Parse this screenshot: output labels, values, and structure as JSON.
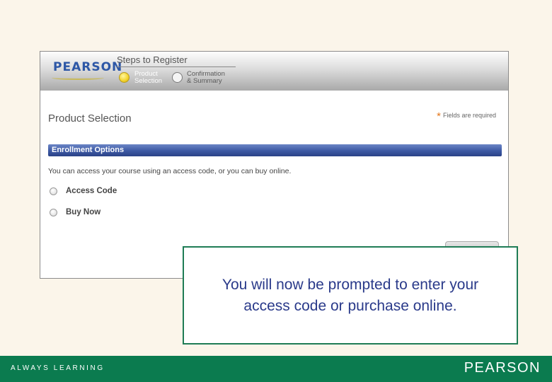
{
  "screenshot": {
    "logo": "PEARSON",
    "steps": {
      "title": "Steps to Register",
      "items": [
        {
          "label_line1": "Product",
          "label_line2": "Selection",
          "state": "active"
        },
        {
          "label_line1": "Confirmation",
          "label_line2": "& Summary",
          "state": "pending"
        }
      ]
    },
    "page_title": "Product Selection",
    "required_star": "*",
    "required_note": "Fields are required",
    "section_title": "Enrollment Options",
    "intro_text": "You can access your course using an access code, or you can buy online.",
    "options": [
      {
        "label": "Access Code"
      },
      {
        "label": "Buy Now"
      }
    ]
  },
  "callout": {
    "line1": "You will now be prompted to enter your",
    "line2": "access code or purchase online."
  },
  "footer": {
    "tagline": "ALWAYS LEARNING",
    "logo": "PEARSON"
  },
  "colors": {
    "background": "#fbf5ea",
    "section_bar": "#3c58a3",
    "footer": "#0b7b4f",
    "active_step": "#f2d22a",
    "callout_border": "#1e7c55",
    "callout_text": "#2a3a8a"
  }
}
